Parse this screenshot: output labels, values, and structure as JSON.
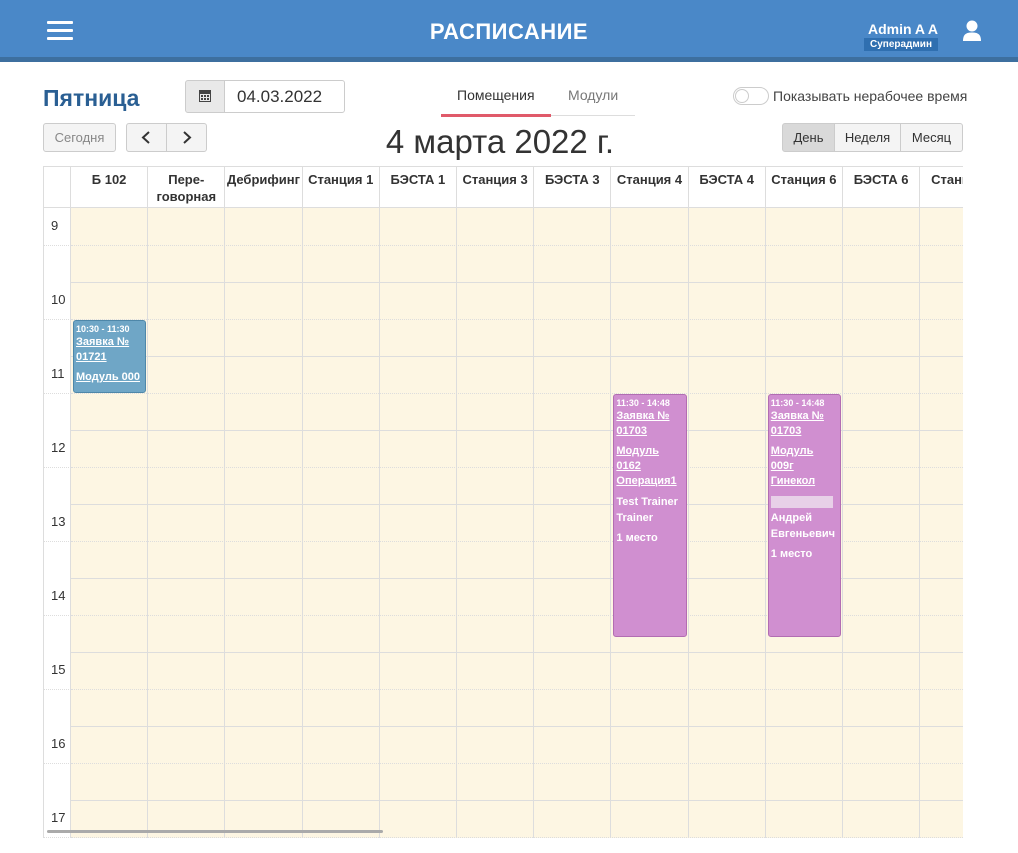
{
  "header": {
    "title": "РАСПИСАНИЕ",
    "user_name": "Admin A A",
    "user_role": "Суперадмин",
    "bg_color": "#4a88c8"
  },
  "toolbar": {
    "day_name": "Пятница",
    "date_value": "04.03.2022",
    "tabs": [
      {
        "label": "Помещения",
        "active": true
      },
      {
        "label": "Модули",
        "active": false
      }
    ],
    "toggle_label": "Показывать нерабочее время",
    "today_label": "Сегодня",
    "prev_icon": "chevron-left-icon",
    "next_icon": "chevron-right-icon",
    "big_date": "4 марта 2022 г.",
    "views": [
      {
        "label": "День",
        "active": true
      },
      {
        "label": "Неделя",
        "active": false
      },
      {
        "label": "Месяц",
        "active": false
      }
    ]
  },
  "calendar": {
    "columns": [
      "Б 102",
      "Пере-\nговорная",
      "Дебрифинг",
      "Станция 1",
      "БЭСТА 1",
      "Станция 3",
      "БЭСТА 3",
      "Станция 4",
      "БЭСТА 4",
      "Станция 6",
      "БЭСТА 6",
      "Станция"
    ],
    "hours": [
      "9",
      "10",
      "11",
      "12",
      "13",
      "14",
      "15",
      "16",
      "17"
    ],
    "events": [
      {
        "column": 0,
        "start": "10:30",
        "end": "11:30",
        "color": "blue",
        "time": "10:30 - 11:30",
        "request": "Заявка № 01721",
        "module": "Модуль 000",
        "extra": []
      },
      {
        "column": 7,
        "start": "11:30",
        "end": "14:48",
        "color": "purple",
        "time": "11:30 - 14:48",
        "request": "Заявка № 01703",
        "module": "Модуль 0162 Операция1",
        "extra": [
          "Test Trainer Trainer",
          "1 место"
        ]
      },
      {
        "column": 9,
        "start": "11:30",
        "end": "14:48",
        "color": "purple",
        "time": "11:30 - 14:48",
        "request": "Заявка № 01703",
        "module": "Модуль 009г Гинекол",
        "extra": [
          "Андрей Евгеньевич",
          "1 место"
        ]
      }
    ]
  }
}
